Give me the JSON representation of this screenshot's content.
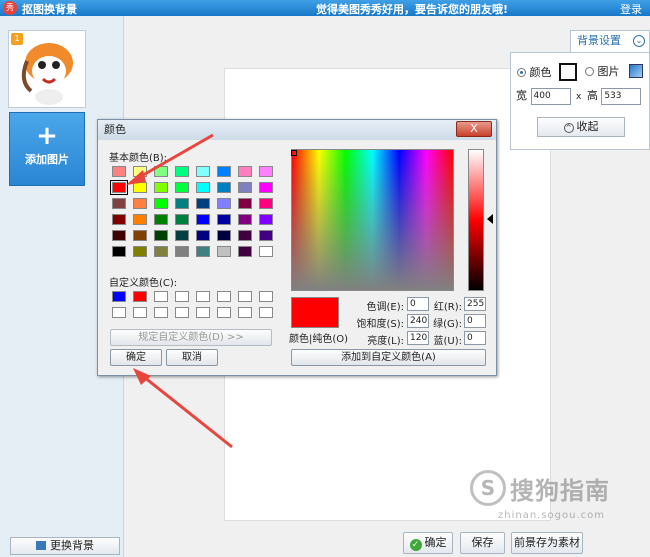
{
  "app": {
    "icon_text": "秀",
    "title": "抠图换背景",
    "slogan": "觉得美图秀秀好用，要告诉您的朋友哦!",
    "login": "登录"
  },
  "left": {
    "thumb_badge": "1",
    "add_image_label": "添加图片",
    "change_bg_label": "更换背景"
  },
  "settings": {
    "tab_label": "背景设置",
    "color_label": "颜色",
    "image_label": "图片",
    "width_label": "宽",
    "width_value": "400",
    "times": "x",
    "height_label": "高",
    "height_value": "533",
    "collapse_label": "收起"
  },
  "bottom": {
    "ok_label": "确定",
    "save_label": "保存",
    "save_fg_label": "前景存为素材"
  },
  "dialog": {
    "title": "颜色",
    "close_label": "X",
    "basic_colors_label": "基本颜色(B):",
    "custom_colors_label": "自定义颜色(C):",
    "define_custom_label": "规定自定义颜色(D) >>",
    "ok_label": "确定",
    "cancel_label": "取消",
    "preview_label": "颜色|纯色(O)",
    "hue_label": "色调(E):",
    "hue_value": "0",
    "sat_label": "饱和度(S):",
    "sat_value": "240",
    "lum_label": "亮度(L):",
    "lum_value": "120",
    "red_label": "红(R):",
    "red_value": "255",
    "green_label": "绿(G):",
    "green_value": "0",
    "blue_label": "蓝(U):",
    "blue_value": "0",
    "add_custom_label": "添加到自定义颜色(A)",
    "basic_colors": [
      "#ff8080",
      "#ffff80",
      "#80ff80",
      "#00ff80",
      "#80ffff",
      "#0080ff",
      "#ff80c0",
      "#ff80ff",
      "#ff0000",
      "#ffff00",
      "#80ff00",
      "#00ff40",
      "#00ffff",
      "#0080c0",
      "#8080c0",
      "#ff00ff",
      "#804040",
      "#ff8040",
      "#00ff00",
      "#008080",
      "#004080",
      "#8080ff",
      "#800040",
      "#ff0080",
      "#800000",
      "#ff8000",
      "#008000",
      "#008040",
      "#0000ff",
      "#0000a0",
      "#800080",
      "#8000ff",
      "#400000",
      "#804000",
      "#004000",
      "#004040",
      "#000080",
      "#000040",
      "#400040",
      "#400080",
      "#000000",
      "#808000",
      "#808040",
      "#808080",
      "#408080",
      "#c0c0c0",
      "#400040",
      "#ffffff"
    ],
    "selected_color": "#ff0000",
    "custom_colors": [
      "#0000ff",
      "#ff0000",
      "#ffffff",
      "#ffffff",
      "#ffffff",
      "#ffffff",
      "#ffffff",
      "#ffffff",
      "#ffffff",
      "#ffffff",
      "#ffffff",
      "#ffffff",
      "#ffffff",
      "#ffffff",
      "#ffffff",
      "#ffffff"
    ]
  },
  "watermark": {
    "logo": "S",
    "text": "搜狗指南",
    "url": "zhinan.sogou.com"
  },
  "colors": {
    "title_bar": "#1878c8",
    "accent": "#2a86d4",
    "arrow": "#e8453c"
  }
}
